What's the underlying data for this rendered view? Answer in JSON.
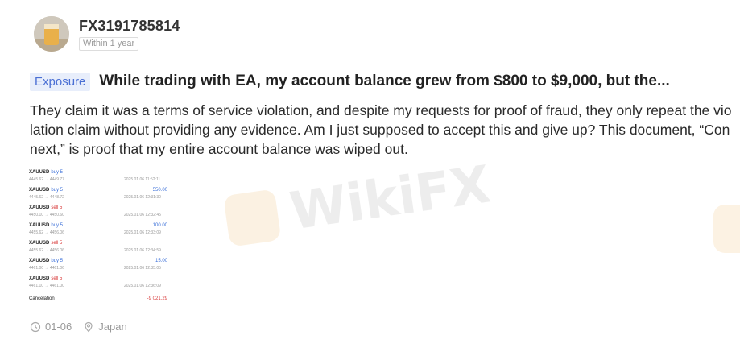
{
  "user": {
    "name": "FX3191785814",
    "time_badge": "Within 1 year",
    "avatar_icon": "user-avatar"
  },
  "post": {
    "tag": "Exposure",
    "title": "While trading with EA, my account balance grew from $800 to $9,000, but the...",
    "body": "They claim it was a terms of service violation, and despite my requests for proof of fraud, they only repeat the violation claim without providing any evidence. Am I just supposed to accept this and give up? This document, “Connext,” is proof that my entire account balance was wiped out."
  },
  "document_image": {
    "trades": [
      {
        "pair": "XAUUSD",
        "dir": "buy 5",
        "dir_type": "buy",
        "prices": "4445.62 → 4449.77",
        "date": "2025.01.06 11:52:11",
        "profit": ""
      },
      {
        "pair": "XAUUSD",
        "dir": "buy 5",
        "dir_type": "buy",
        "prices": "4445.62 → 4448.72",
        "date": "2025.01.06 12:31:30",
        "profit": "550.00"
      },
      {
        "pair": "XAUUSD",
        "dir": "sell 5",
        "dir_type": "sell",
        "prices": "4450.10 → 4450.60",
        "date": "2025.01.06 12:32:45",
        "profit": ""
      },
      {
        "pair": "XAUUSD",
        "dir": "buy 5",
        "dir_type": "buy",
        "prices": "4455.62 → 4456.06",
        "date": "2025.01.06 12:33:09",
        "profit": "100.00"
      },
      {
        "pair": "XAUUSD",
        "dir": "sell 5",
        "dir_type": "sell",
        "prices": "4455.62 → 4456.06",
        "date": "2025.01.06 12:34:59",
        "profit": ""
      },
      {
        "pair": "XAUUSD",
        "dir": "buy 5",
        "dir_type": "buy",
        "prices": "4461.00 → 4461.06",
        "date": "2025.01.06 12:35:05",
        "profit": "15.00"
      },
      {
        "pair": "XAUUSD",
        "dir": "sell 5",
        "dir_type": "sell",
        "prices": "4461.10 → 4461.00",
        "date": "2025.01.06 12:36:09",
        "profit": ""
      }
    ],
    "cancel_label": "Cancelation",
    "cancel_amount": "-9 021.29"
  },
  "watermark": {
    "text": "WikiFX"
  },
  "meta": {
    "date": "01-06",
    "location": "Japan",
    "clock_icon": "clock-icon",
    "location_icon": "location-pin-icon"
  }
}
